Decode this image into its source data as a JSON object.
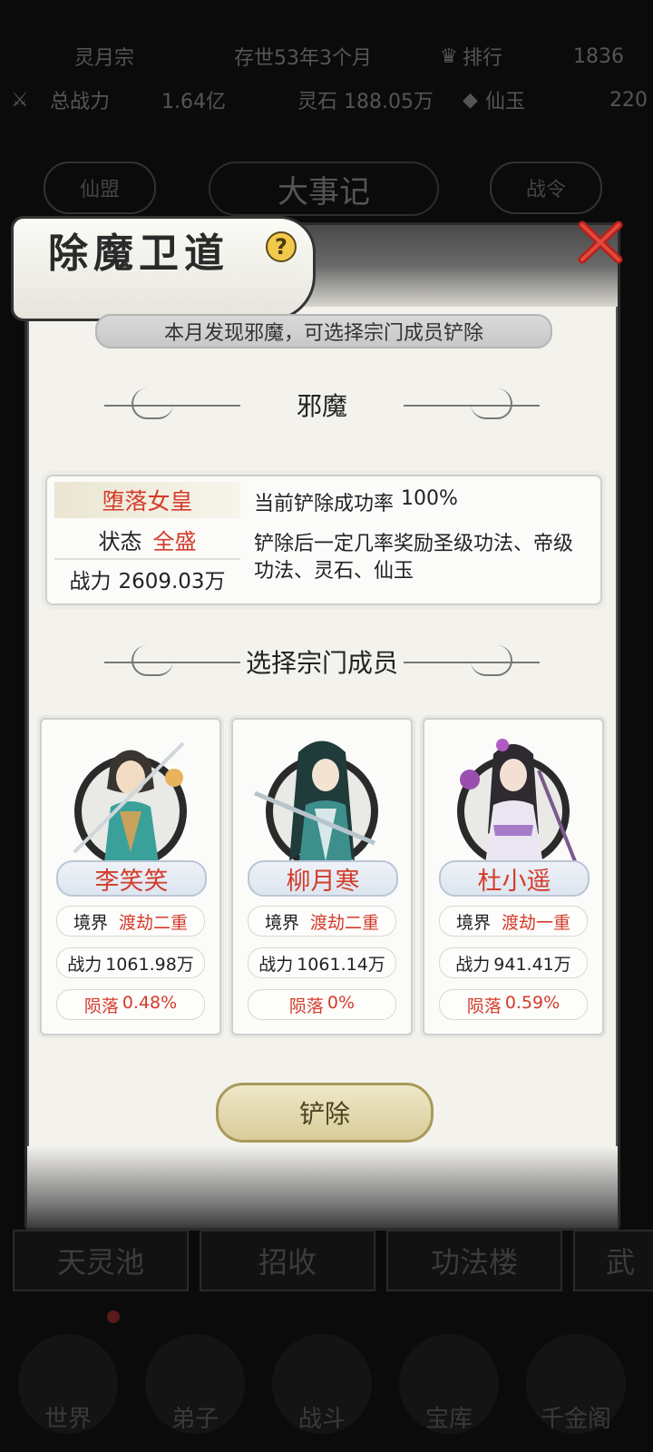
{
  "background": {
    "sect_name": "灵月宗",
    "survival": "存世53年3个月",
    "rank_label": "排行",
    "rank_value": "1836",
    "total_power_label": "总战力",
    "total_power_value": "1.64亿",
    "spirit_stone": "灵石 188.05万",
    "jade_label": "仙玉",
    "jade_value": "220",
    "left_tab": "仙盟",
    "center_title": "大事记",
    "right_tab": "战令",
    "buttons": [
      "天灵池",
      "招收",
      "功法楼",
      "武"
    ],
    "nav": [
      "世界",
      "弟子",
      "战斗",
      "宝库",
      "千金阁"
    ]
  },
  "modal": {
    "title": "除魔卫道",
    "help_symbol": "?",
    "notice": "本月发现邪魔，可选择宗门成员铲除",
    "demon_section_title": "邪魔",
    "demon": {
      "name": "堕落女皇",
      "status_label": "状态",
      "status_value": "全盛",
      "power_label": "战力",
      "power_value": "2609.03万",
      "rate_label": "当前铲除成功率",
      "rate_value": "100%",
      "reward_text": "铲除后一定几率奖励圣级功法、帝级功法、灵石、仙玉"
    },
    "member_section_title": "选择宗门成员",
    "members": [
      {
        "name": "李笑笑",
        "realm_label": "境界",
        "realm": "渡劫二重",
        "power_label": "战力",
        "power": "1061.98万",
        "fall_label": "陨落",
        "fall_rate": "0.48%"
      },
      {
        "name": "柳月寒",
        "realm_label": "境界",
        "realm": "渡劫二重",
        "power_label": "战力",
        "power": "1061.14万",
        "fall_label": "陨落",
        "fall_rate": "0%"
      },
      {
        "name": "杜小遥",
        "realm_label": "境界",
        "realm": "渡劫一重",
        "power_label": "战力",
        "power": "941.41万",
        "fall_label": "陨落",
        "fall_rate": "0.59%"
      }
    ],
    "action_label": "铲除"
  },
  "colors": {
    "accent_red": "#d43b2a",
    "gold_button": "#d9cc9a",
    "panel": "#f3f2ed"
  }
}
